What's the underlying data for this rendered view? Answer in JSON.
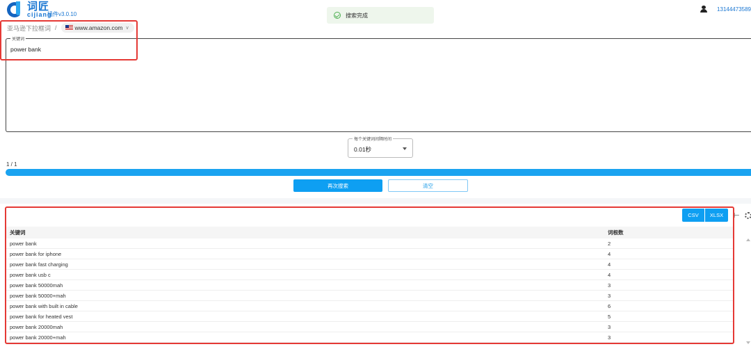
{
  "header": {
    "logo_cn": "词匠",
    "logo_en": "cijiang",
    "version": "插件v3.0.10",
    "toast": "搜索完成",
    "user_id": "13144473589"
  },
  "breadcrumb": {
    "section": "亚马逊下拉框词",
    "separator": "/",
    "domain": "www.amazon.com"
  },
  "keyword_field": {
    "label": "关键词",
    "value": "power bank"
  },
  "interval": {
    "label": "每个关键词间隔时间",
    "value": "0.01秒"
  },
  "progress": {
    "text": "1 / 1",
    "fraction": 1.0
  },
  "buttons": {
    "search_again": "再次搜索",
    "clear": "清空"
  },
  "export": {
    "csv": "CSV",
    "xlsx": "XLSX"
  },
  "table": {
    "headers": [
      "关键词",
      "词根数"
    ],
    "rows": [
      {
        "keyword": "power bank",
        "roots": "2"
      },
      {
        "keyword": "power bank for iphone",
        "roots": "4"
      },
      {
        "keyword": "power bank fast charging",
        "roots": "4"
      },
      {
        "keyword": "power bank usb c",
        "roots": "4"
      },
      {
        "keyword": "power bank 50000mah",
        "roots": "3"
      },
      {
        "keyword": "power bank 50000+mah",
        "roots": "3"
      },
      {
        "keyword": "power bank with built in cable",
        "roots": "6"
      },
      {
        "keyword": "power bank for heated vest",
        "roots": "5"
      },
      {
        "keyword": "power bank 20000mah",
        "roots": "3"
      },
      {
        "keyword": "power bank 20000+mah",
        "roots": "3"
      }
    ]
  },
  "colors": {
    "primary": "#0e9ff2",
    "annotation": "#e53935"
  }
}
